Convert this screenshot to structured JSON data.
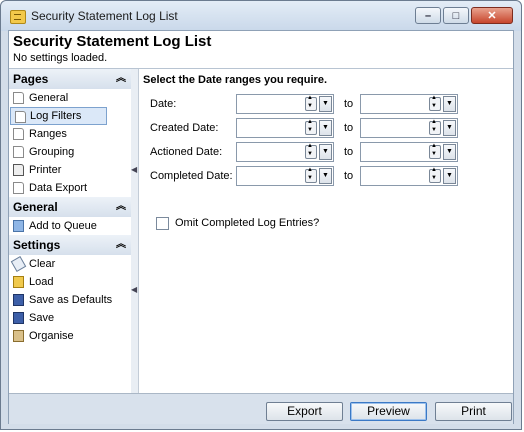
{
  "window": {
    "title": "Security Statement Log List",
    "min": "–",
    "max": "□",
    "close": "✕"
  },
  "header": {
    "title": "Security Statement Log List",
    "subtitle": "No settings loaded."
  },
  "sidebar": {
    "pages": {
      "label": "Pages",
      "items": [
        "General",
        "Log Filters",
        "Ranges",
        "Grouping",
        "Printer",
        "Data Export"
      ]
    },
    "general": {
      "label": "General",
      "items": [
        "Add to Queue"
      ]
    },
    "settings": {
      "label": "Settings",
      "items": [
        "Clear",
        "Load",
        "Save as Defaults",
        "Save",
        "Organise"
      ]
    }
  },
  "main": {
    "heading": "Select the Date ranges you require.",
    "to_label": "to",
    "rows": [
      {
        "label": "Date:"
      },
      {
        "label": "Created Date:"
      },
      {
        "label": "Actioned Date:"
      },
      {
        "label": "Completed Date:"
      }
    ],
    "omit_label": "Omit Completed Log Entries?",
    "omit_checked": false
  },
  "footer": {
    "export": "Export",
    "preview": "Preview",
    "print": "Print"
  },
  "colors": {
    "selected_bg": "#dbe8f8",
    "accent": "#3b79c5"
  }
}
